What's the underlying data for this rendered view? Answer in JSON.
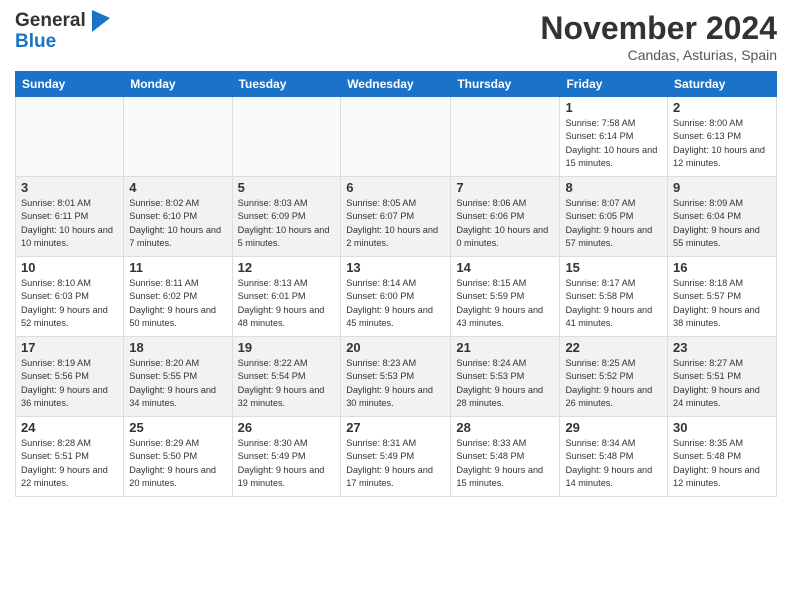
{
  "header": {
    "logo_line1": "General",
    "logo_line2": "Blue",
    "month": "November 2024",
    "location": "Candas, Asturias, Spain"
  },
  "weekdays": [
    "Sunday",
    "Monday",
    "Tuesday",
    "Wednesday",
    "Thursday",
    "Friday",
    "Saturday"
  ],
  "weeks": [
    [
      {
        "day": "",
        "info": ""
      },
      {
        "day": "",
        "info": ""
      },
      {
        "day": "",
        "info": ""
      },
      {
        "day": "",
        "info": ""
      },
      {
        "day": "",
        "info": ""
      },
      {
        "day": "1",
        "info": "Sunrise: 7:58 AM\nSunset: 6:14 PM\nDaylight: 10 hours and 15 minutes."
      },
      {
        "day": "2",
        "info": "Sunrise: 8:00 AM\nSunset: 6:13 PM\nDaylight: 10 hours and 12 minutes."
      }
    ],
    [
      {
        "day": "3",
        "info": "Sunrise: 8:01 AM\nSunset: 6:11 PM\nDaylight: 10 hours and 10 minutes."
      },
      {
        "day": "4",
        "info": "Sunrise: 8:02 AM\nSunset: 6:10 PM\nDaylight: 10 hours and 7 minutes."
      },
      {
        "day": "5",
        "info": "Sunrise: 8:03 AM\nSunset: 6:09 PM\nDaylight: 10 hours and 5 minutes."
      },
      {
        "day": "6",
        "info": "Sunrise: 8:05 AM\nSunset: 6:07 PM\nDaylight: 10 hours and 2 minutes."
      },
      {
        "day": "7",
        "info": "Sunrise: 8:06 AM\nSunset: 6:06 PM\nDaylight: 10 hours and 0 minutes."
      },
      {
        "day": "8",
        "info": "Sunrise: 8:07 AM\nSunset: 6:05 PM\nDaylight: 9 hours and 57 minutes."
      },
      {
        "day": "9",
        "info": "Sunrise: 8:09 AM\nSunset: 6:04 PM\nDaylight: 9 hours and 55 minutes."
      }
    ],
    [
      {
        "day": "10",
        "info": "Sunrise: 8:10 AM\nSunset: 6:03 PM\nDaylight: 9 hours and 52 minutes."
      },
      {
        "day": "11",
        "info": "Sunrise: 8:11 AM\nSunset: 6:02 PM\nDaylight: 9 hours and 50 minutes."
      },
      {
        "day": "12",
        "info": "Sunrise: 8:13 AM\nSunset: 6:01 PM\nDaylight: 9 hours and 48 minutes."
      },
      {
        "day": "13",
        "info": "Sunrise: 8:14 AM\nSunset: 6:00 PM\nDaylight: 9 hours and 45 minutes."
      },
      {
        "day": "14",
        "info": "Sunrise: 8:15 AM\nSunset: 5:59 PM\nDaylight: 9 hours and 43 minutes."
      },
      {
        "day": "15",
        "info": "Sunrise: 8:17 AM\nSunset: 5:58 PM\nDaylight: 9 hours and 41 minutes."
      },
      {
        "day": "16",
        "info": "Sunrise: 8:18 AM\nSunset: 5:57 PM\nDaylight: 9 hours and 38 minutes."
      }
    ],
    [
      {
        "day": "17",
        "info": "Sunrise: 8:19 AM\nSunset: 5:56 PM\nDaylight: 9 hours and 36 minutes."
      },
      {
        "day": "18",
        "info": "Sunrise: 8:20 AM\nSunset: 5:55 PM\nDaylight: 9 hours and 34 minutes."
      },
      {
        "day": "19",
        "info": "Sunrise: 8:22 AM\nSunset: 5:54 PM\nDaylight: 9 hours and 32 minutes."
      },
      {
        "day": "20",
        "info": "Sunrise: 8:23 AM\nSunset: 5:53 PM\nDaylight: 9 hours and 30 minutes."
      },
      {
        "day": "21",
        "info": "Sunrise: 8:24 AM\nSunset: 5:53 PM\nDaylight: 9 hours and 28 minutes."
      },
      {
        "day": "22",
        "info": "Sunrise: 8:25 AM\nSunset: 5:52 PM\nDaylight: 9 hours and 26 minutes."
      },
      {
        "day": "23",
        "info": "Sunrise: 8:27 AM\nSunset: 5:51 PM\nDaylight: 9 hours and 24 minutes."
      }
    ],
    [
      {
        "day": "24",
        "info": "Sunrise: 8:28 AM\nSunset: 5:51 PM\nDaylight: 9 hours and 22 minutes."
      },
      {
        "day": "25",
        "info": "Sunrise: 8:29 AM\nSunset: 5:50 PM\nDaylight: 9 hours and 20 minutes."
      },
      {
        "day": "26",
        "info": "Sunrise: 8:30 AM\nSunset: 5:49 PM\nDaylight: 9 hours and 19 minutes."
      },
      {
        "day": "27",
        "info": "Sunrise: 8:31 AM\nSunset: 5:49 PM\nDaylight: 9 hours and 17 minutes."
      },
      {
        "day": "28",
        "info": "Sunrise: 8:33 AM\nSunset: 5:48 PM\nDaylight: 9 hours and 15 minutes."
      },
      {
        "day": "29",
        "info": "Sunrise: 8:34 AM\nSunset: 5:48 PM\nDaylight: 9 hours and 14 minutes."
      },
      {
        "day": "30",
        "info": "Sunrise: 8:35 AM\nSunset: 5:48 PM\nDaylight: 9 hours and 12 minutes."
      }
    ]
  ]
}
